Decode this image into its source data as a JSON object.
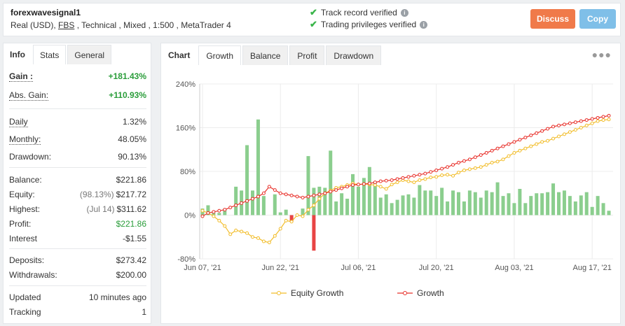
{
  "account": {
    "name": "forexwavesignal1",
    "meta_prefix": "Real (USD), ",
    "meta_broker": "FBS",
    "meta_suffix": " , Technical , Mixed , 1:500 , MetaTrader 4"
  },
  "verification": {
    "track_record": "Track record verified",
    "trading_privileges": "Trading privileges verified"
  },
  "buttons": {
    "discuss": "Discuss",
    "copy": "Copy"
  },
  "left_tabs": [
    "Info",
    "Stats",
    "General"
  ],
  "stats": {
    "gain_label": "Gain :",
    "gain_value": "+181.43%",
    "abs_gain_label": "Abs. Gain:",
    "abs_gain_value": "+110.93%",
    "daily_label": "Daily",
    "daily_value": "1.32%",
    "monthly_label": "Monthly:",
    "monthly_value": "48.05%",
    "drawdown_label": "Drawdown:",
    "drawdown_value": "90.13%",
    "balance_label": "Balance:",
    "balance_value": "$221.86",
    "equity_label": "Equity:",
    "equity_sub": "(98.13%)",
    "equity_value": "$217.72",
    "highest_label": "Highest:",
    "highest_sub": "(Jul 14)",
    "highest_value": "$311.62",
    "profit_label": "Profit:",
    "profit_value": "$221.86",
    "interest_label": "Interest",
    "interest_value": "-$1.55",
    "deposits_label": "Deposits:",
    "deposits_value": "$273.42",
    "withdrawals_label": "Withdrawals:",
    "withdrawals_value": "$200.00",
    "updated_label": "Updated",
    "updated_value": "10 minutes ago",
    "tracking_label": "Tracking",
    "tracking_value": "1"
  },
  "chart_tabs": [
    "Chart",
    "Growth",
    "Balance",
    "Profit",
    "Drawdown"
  ],
  "more_icon": "more-dots-icon",
  "colors": {
    "growth": "#e8302a",
    "equity": "#f2bd2a",
    "bar_pos": "#8bce8e",
    "bar_neg": "#e84444",
    "accent_discuss": "#f07a4a",
    "accent_copy": "#7fbfe8"
  },
  "chart_data": {
    "type": "line",
    "ylim": [
      -80,
      240
    ],
    "yticks": [
      "240%",
      "160%",
      "80%",
      "0%",
      "-80%"
    ],
    "ytick_values": [
      240,
      160,
      80,
      0,
      -80
    ],
    "xticks": [
      "Jun 07, '21",
      "Jun 22, '21",
      "Jul 06, '21",
      "Jul 20, '21",
      "Aug 03, '21",
      "Aug 17, '21"
    ],
    "xtick_index": [
      0,
      14,
      28,
      42,
      56,
      70
    ],
    "n_points": 74,
    "series": [
      {
        "name": "Equity Growth",
        "values": [
          8,
          4,
          -2,
          -10,
          -20,
          -35,
          -28,
          -30,
          -33,
          -40,
          -42,
          -48,
          -50,
          -38,
          -25,
          -10,
          -12,
          0,
          -2,
          10,
          18,
          30,
          40,
          45,
          50,
          52,
          55,
          58,
          56,
          57,
          56,
          55,
          52,
          48,
          56,
          60,
          64,
          62,
          60,
          64,
          66,
          69,
          70,
          73,
          74,
          72,
          78,
          82,
          84,
          86,
          88,
          92,
          96,
          98,
          102,
          108,
          114,
          118,
          122,
          126,
          130,
          134,
          136,
          140,
          144,
          148,
          152,
          156,
          160,
          164,
          168,
          172,
          174,
          175
        ]
      },
      {
        "name": "Growth",
        "values": [
          -2,
          4,
          6,
          8,
          10,
          14,
          18,
          22,
          26,
          30,
          34,
          40,
          52,
          46,
          40,
          38,
          36,
          34,
          32,
          34,
          36,
          38,
          40,
          43,
          46,
          49,
          52,
          55,
          56,
          57,
          58,
          60,
          62,
          63,
          64,
          66,
          68,
          70,
          72,
          74,
          76,
          79,
          82,
          85,
          88,
          92,
          96,
          99,
          102,
          106,
          110,
          114,
          118,
          122,
          126,
          130,
          134,
          138,
          142,
          146,
          150,
          154,
          158,
          162,
          164,
          166,
          168,
          170,
          172,
          174,
          176,
          178,
          180,
          182
        ]
      }
    ],
    "bars": [
      12,
      18,
      5,
      4,
      12,
      0,
      52,
      45,
      128,
      45,
      175,
      35,
      0,
      38,
      5,
      10,
      0,
      0,
      12,
      108,
      50,
      52,
      50,
      118,
      25,
      40,
      30,
      75,
      52,
      68,
      88,
      62,
      32,
      38,
      22,
      28,
      36,
      38,
      32,
      55,
      45,
      45,
      35,
      50,
      25,
      45,
      42,
      25,
      45,
      42,
      32,
      45,
      42,
      60,
      35,
      40,
      22,
      48,
      22,
      35,
      40,
      40,
      42,
      58,
      42,
      45,
      35,
      25,
      36,
      42,
      15,
      35,
      22,
      8
    ],
    "bars_neg": [
      0,
      0,
      0,
      0,
      0,
      0,
      0,
      0,
      0,
      0,
      0,
      0,
      0,
      0,
      0,
      0,
      -12,
      0,
      0,
      0,
      -65
    ],
    "legend": [
      "Equity Growth",
      "Growth"
    ]
  }
}
